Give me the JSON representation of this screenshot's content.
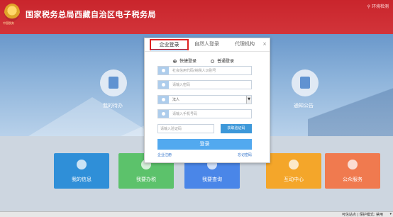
{
  "header": {
    "title": "国家税务总局西藏自治区电子税务局",
    "emblem_text": "中国税务",
    "env_link": "环境检测"
  },
  "hero": {
    "left_label": "我的待办",
    "right_label": "通知公告"
  },
  "tiles": [
    {
      "label": "我的信息",
      "color": "#2f8fd8"
    },
    {
      "label": "我要办税",
      "color": "#5cc26b"
    },
    {
      "label": "我要查询",
      "color": "#4a86e8"
    },
    {
      "label": "互动中心",
      "color": "#f4a62a"
    },
    {
      "label": "公众服务",
      "color": "#f07a4f"
    }
  ],
  "status": {
    "text": "可信站点 | 保护模式: 禁用",
    "zoom": "▾"
  },
  "login": {
    "tabs": [
      "企业登录",
      "自然人登录",
      "代理机构"
    ],
    "close": "×",
    "radio_quick": "快捷登录",
    "radio_normal": "普通登录",
    "fields": {
      "credit_code": "社会信用代码/纳税人识别号",
      "password": "请输入密码",
      "role": "法人",
      "phone": "请输入手机号码",
      "captcha": "请输入验证码"
    },
    "captcha_button": "获取验证码",
    "submit": "登录",
    "register": "企业注册",
    "forgot": "忘记密码"
  }
}
